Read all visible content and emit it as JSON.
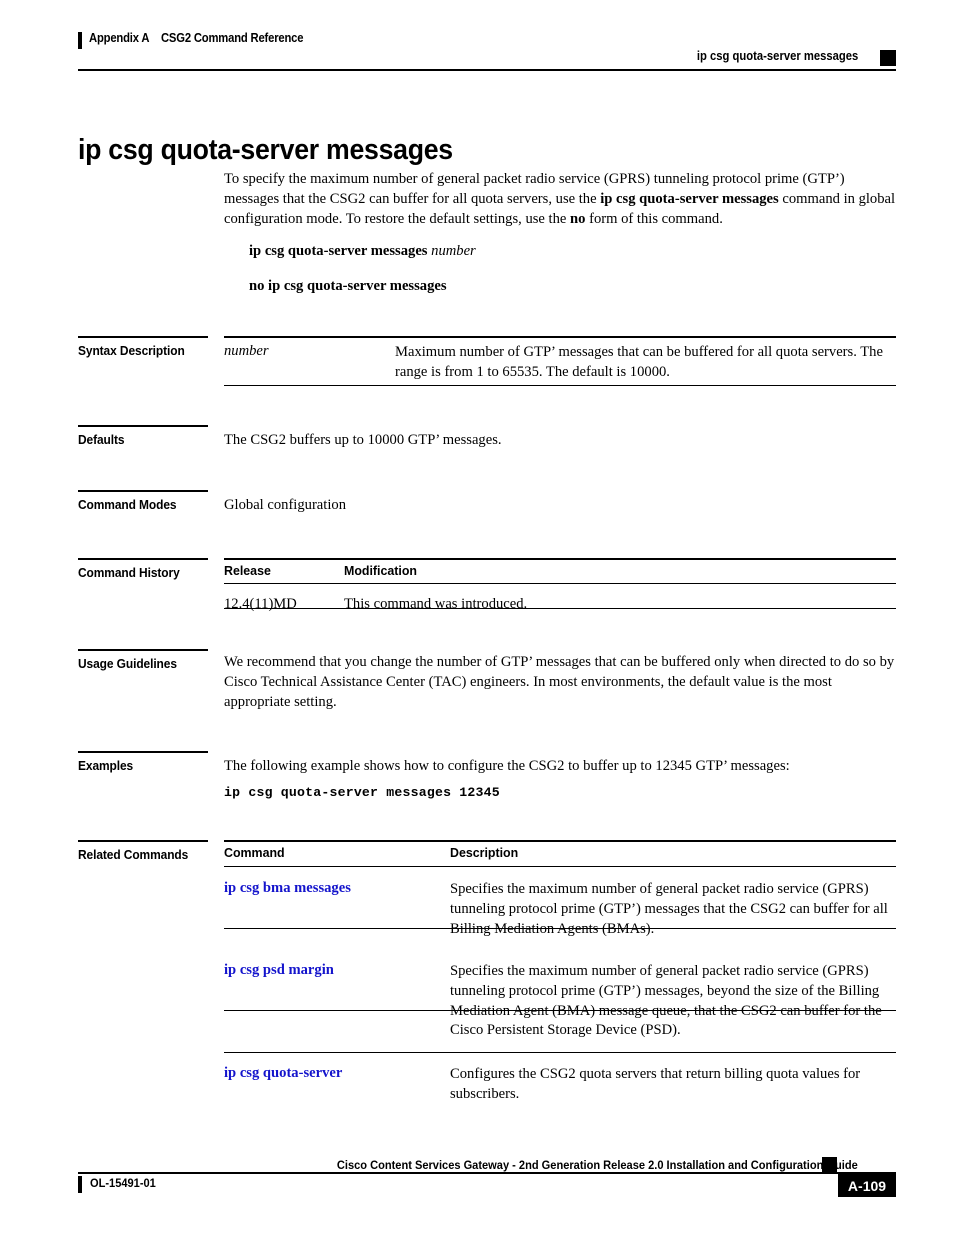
{
  "header": {
    "appendix": "Appendix A",
    "chapter": "CSG2 Command Reference",
    "running_command": "ip csg quota-server messages"
  },
  "command": {
    "title": "ip csg quota-server messages",
    "intro_part1": "To specify the maximum number of general packet radio service (GPRS) tunneling protocol prime (GTP’) messages that the CSG2 can buffer for all quota servers, use the ",
    "intro_bold1": "ip csg quota-server messages",
    "intro_part2": " command in global configuration mode. To restore the default settings, use the ",
    "intro_bold2": "no",
    "intro_part3": " form of this command.",
    "syntax_command": "ip csg quota-server messages",
    "syntax_argument": "number",
    "no_form": "no ip csg quota-server messages"
  },
  "sections": {
    "syntax_description": {
      "label": "Syntax Description",
      "rows": [
        {
          "term": "number",
          "description": "Maximum number of GTP’ messages that can be buffered for all quota servers. The range is from 1 to 65535. The default is 10000."
        }
      ]
    },
    "defaults": {
      "label": "Defaults",
      "text": "The CSG2 buffers up to 10000 GTP’ messages."
    },
    "command_modes": {
      "label": "Command Modes",
      "text": "Global configuration"
    },
    "command_history": {
      "label": "Command History",
      "columns": [
        "Release",
        "Modification"
      ],
      "rows": [
        {
          "release": "12.4(11)MD",
          "modification": "This command was introduced."
        }
      ]
    },
    "usage_guidelines": {
      "label": "Usage Guidelines",
      "text": "We recommend that you change the number of GTP’ messages that can be buffered only when directed to do so by Cisco Technical Assistance Center (TAC) engineers. In most environments, the default value is the most appropriate setting."
    },
    "examples": {
      "label": "Examples",
      "text": "The following example shows how to configure the CSG2 to buffer up to 12345 GTP’ messages:",
      "code": "ip csg quota-server messages 12345"
    },
    "related_commands": {
      "label": "Related Commands",
      "columns": [
        "Command",
        "Description"
      ],
      "rows": [
        {
          "command": "ip csg bma messages",
          "description": "Specifies the maximum number of general packet radio service (GPRS) tunneling protocol prime (GTP’) messages that the CSG2 can buffer for all Billing Mediation Agents (BMAs)."
        },
        {
          "command": "ip csg psd margin",
          "description": "Specifies the maximum number of general packet radio service (GPRS) tunneling protocol prime (GTP’) messages, beyond the size of the Billing Mediation Agent (BMA) message queue, that the CSG2 can buffer for the Cisco Persistent Storage Device (PSD)."
        },
        {
          "command": "ip csg quota-server",
          "description": "Configures the CSG2 quota servers that return billing quota values for subscribers."
        }
      ]
    }
  },
  "footer": {
    "doc_title": "Cisco Content Services Gateway - 2nd Generation Release 2.0 Installation and Configuration Guide",
    "doc_id": "OL-15491-01",
    "page_number": "A-109"
  },
  "colors": {
    "link": "#1414cc",
    "text": "#000000",
    "background": "#ffffff"
  }
}
